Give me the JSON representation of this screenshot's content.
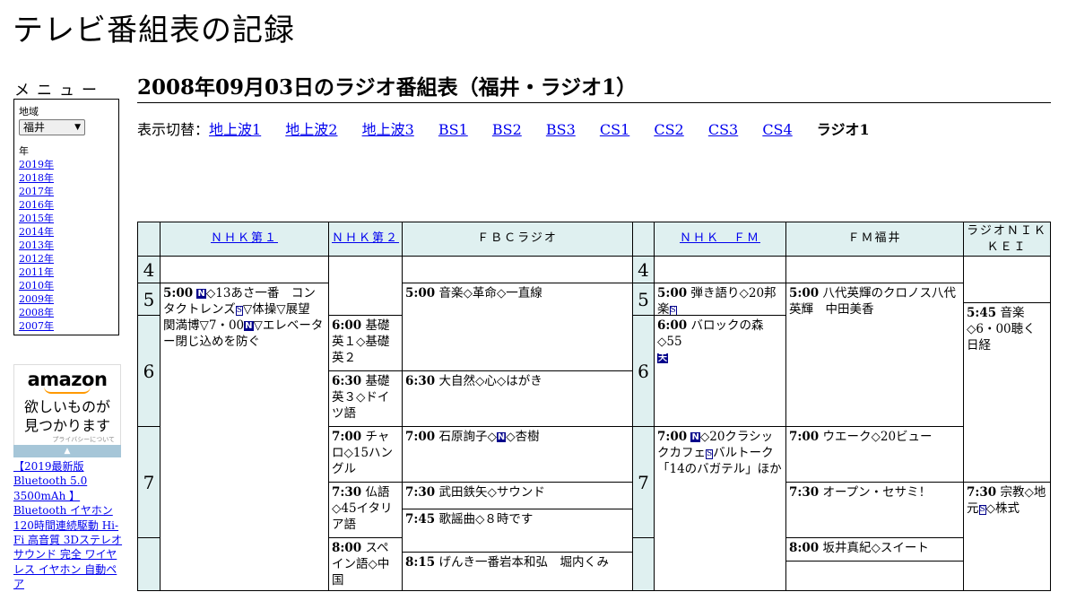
{
  "site_title": "テレビ番組表の記録",
  "menu": {
    "heading": "メニュー",
    "region_label": "地域",
    "region_value": "福井",
    "year_label": "年",
    "years": [
      "2019年",
      "2018年",
      "2017年",
      "2016年",
      "2015年",
      "2014年",
      "2013年",
      "2012年",
      "2011年",
      "2010年",
      "2009年",
      "2008年",
      "2007年"
    ]
  },
  "ad": {
    "logo": "amazon",
    "message_line1": "欲しいものが",
    "message_line2": "見つかります",
    "privacy": "プライバシーについて",
    "product_text": "【2019最新版 Bluetooth 5.0 3500mAh 】Bluetooth イヤホン 120時間連続駆動 Hi-Fi 高音質 3Dステレオサウンド 完全 ワイヤレス イヤホン 自動ペア"
  },
  "page_title": "2008年09月03日のラジオ番組表（福井・ラジオ1）",
  "switcher": {
    "prefix": "表示切替：",
    "links": [
      "地上波1",
      "地上波2",
      "地上波3",
      "BS1",
      "BS2",
      "BS3",
      "CS1",
      "CS2",
      "CS3",
      "CS4"
    ],
    "current": "ラジオ1"
  },
  "channels": [
    {
      "name": "ＮＨＫ第１",
      "link": true
    },
    {
      "name": "ＮＨＫ第２",
      "link": true
    },
    {
      "name": "ＦＢＣラジオ",
      "link": false
    },
    {
      "name": "ＮＨＫ　ＦＭ",
      "link": true
    },
    {
      "name": "ＦＭ福井",
      "link": false
    },
    {
      "name": "ラジオＮＩＫＫＥＩ",
      "link": false
    }
  ],
  "hours": [
    "4",
    "5",
    "6",
    "7",
    "4",
    "5",
    "6",
    "7"
  ],
  "badges": {
    "news": "N",
    "stereo": "S",
    "weather": "天"
  },
  "programs": {
    "nhk1_500": {
      "time": "5:00",
      "pre": "",
      "post": "◇13あさ一番　コンタクトレンズ",
      "post2": "▽体操▽展望　関満博▽7・00",
      "post3": "▽エレベーター閉じ込めを防ぐ"
    },
    "nhk2_600": {
      "time": "6:00",
      "title": "基礎英１◇基礎英２"
    },
    "nhk2_630": {
      "time": "6:30",
      "title": "基礎英３◇ドイツ語"
    },
    "nhk2_700": {
      "time": "7:00",
      "title": "チャロ◇15ハングル"
    },
    "nhk2_730": {
      "time": "7:30",
      "title": "仏語◇45イタリア語"
    },
    "nhk2_800": {
      "time": "8:00",
      "title": "スペイン語◇中国"
    },
    "fbc_500": {
      "time": "5:00",
      "title": "音楽◇革命◇一直線"
    },
    "fbc_630": {
      "time": "6:30",
      "title": "大自然◇心◇はがき"
    },
    "fbc_700": {
      "time": "7:00",
      "pre": "石原詢子◇",
      "post": "◇杏樹"
    },
    "fbc_730": {
      "time": "7:30",
      "title": "武田鉄矢◇サウンド"
    },
    "fbc_745": {
      "time": "7:45",
      "title": "歌謡曲◇８時です"
    },
    "fbc_815": {
      "time": "8:15",
      "title": "げんき一番岩本和弘　堀内くみ"
    },
    "fm_500": {
      "time": "5:00",
      "title": "弾き語り◇20邦楽"
    },
    "fm_600": {
      "time": "6:00",
      "title": "バロックの森◇55"
    },
    "fm_700": {
      "time": "7:00",
      "post": "◇20クラシックカフェ",
      "post2": "バルトーク「14のバガテル」ほか"
    },
    "fmf_500": {
      "time": "5:00",
      "title": "八代英輝のクロノス八代英輝　中田美香"
    },
    "fmf_700": {
      "time": "7:00",
      "title": "ウエーク◇20ビュー"
    },
    "fmf_730": {
      "time": "7:30",
      "title": "オープン・セサミ！"
    },
    "fmf_800": {
      "time": "8:00",
      "title": "坂井真紀◇スイート"
    },
    "nik_545": {
      "time": "5:45",
      "title": "音楽◇6・00聴く日経"
    },
    "nik_730": {
      "time": "7:30",
      "pre": "宗教◇地元",
      "post": "◇株式"
    }
  }
}
